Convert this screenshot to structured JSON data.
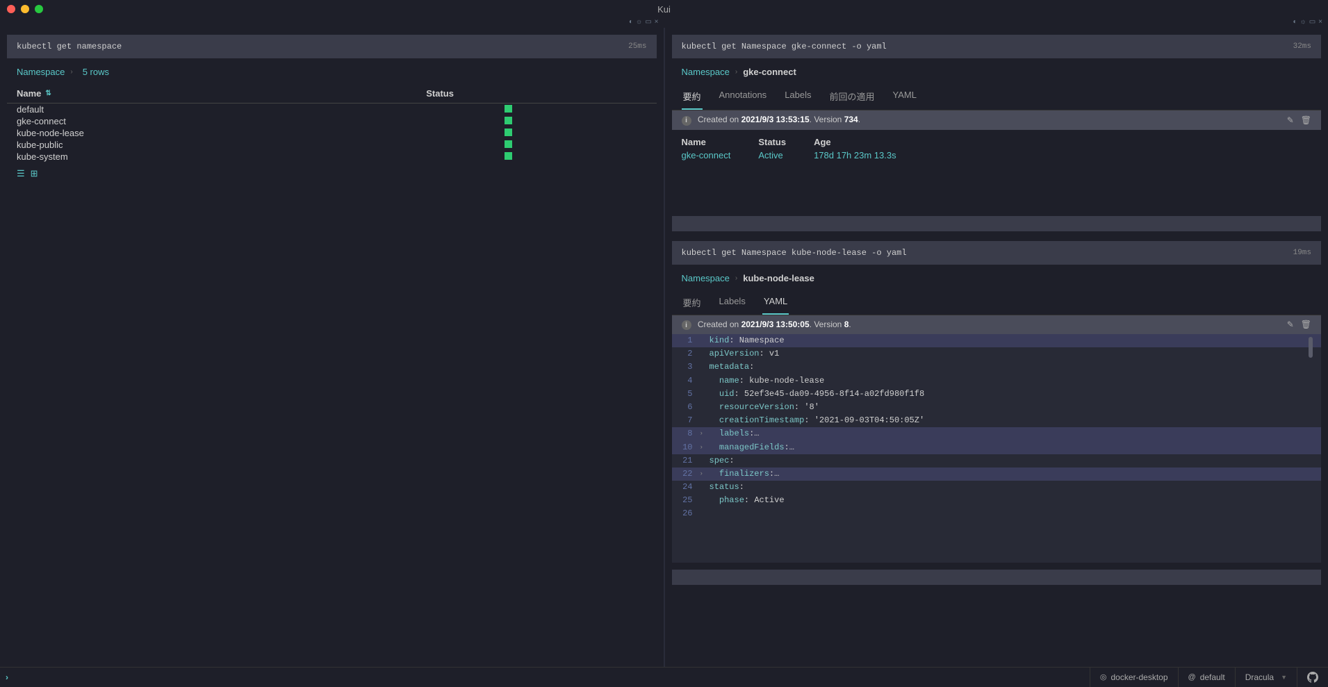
{
  "app_title": "Kui",
  "left_pane": {
    "command": "kubectl get namespace",
    "timing": "25ms",
    "breadcrumb_root": "Namespace",
    "breadcrumb_sub": "5 rows",
    "headers": {
      "name": "Name",
      "status": "Status"
    },
    "rows": [
      {
        "name": "default"
      },
      {
        "name": "gke-connect"
      },
      {
        "name": "kube-node-lease"
      },
      {
        "name": "kube-public"
      },
      {
        "name": "kube-system"
      }
    ]
  },
  "right_block1": {
    "command": "kubectl get Namespace gke-connect -o yaml",
    "timing": "32ms",
    "breadcrumb_root": "Namespace",
    "breadcrumb_current": "gke-connect",
    "tabs": [
      "要約",
      "Annotations",
      "Labels",
      "前回の適用",
      "YAML"
    ],
    "active_tab": 0,
    "info_prefix": "Created on ",
    "info_date": "2021/9/3 13:53:15",
    "info_mid": ". Version ",
    "info_version": "734",
    "info_suffix": ".",
    "summary": {
      "name_label": "Name",
      "name_val": "gke-connect",
      "status_label": "Status",
      "status_val": "Active",
      "age_label": "Age",
      "age_val": "178d 17h 23m 13.3s"
    }
  },
  "right_block2": {
    "command": "kubectl get Namespace kube-node-lease -o yaml",
    "timing": "19ms",
    "breadcrumb_root": "Namespace",
    "breadcrumb_current": "kube-node-lease",
    "tabs": [
      "要約",
      "Labels",
      "YAML"
    ],
    "active_tab": 2,
    "info_prefix": "Created on ",
    "info_date": "2021/9/3 13:50:05",
    "info_mid": ". Version ",
    "info_version": "8",
    "info_suffix": ".",
    "yaml": [
      {
        "n": "1",
        "hl": true,
        "fold": "",
        "key": "kind",
        "sep": ": ",
        "val": "Namespace"
      },
      {
        "n": "2",
        "hl": false,
        "fold": "",
        "key": "apiVersion",
        "sep": ": ",
        "val": "v1"
      },
      {
        "n": "3",
        "hl": false,
        "fold": "",
        "key": "metadata",
        "sep": ":",
        "val": ""
      },
      {
        "n": "4",
        "hl": false,
        "fold": "",
        "key": "  name",
        "sep": ": ",
        "val": "kube-node-lease"
      },
      {
        "n": "5",
        "hl": false,
        "fold": "",
        "key": "  uid",
        "sep": ": ",
        "val": "52ef3e45-da09-4956-8f14-a02fd980f1f8"
      },
      {
        "n": "6",
        "hl": false,
        "fold": "",
        "key": "  resourceVersion",
        "sep": ": ",
        "val": "'8'"
      },
      {
        "n": "7",
        "hl": false,
        "fold": "",
        "key": "  creationTimestamp",
        "sep": ": ",
        "val": "'2021-09-03T04:50:05Z'"
      },
      {
        "n": "8",
        "hl": true,
        "fold": "›",
        "key": "  labels",
        "sep": ":",
        "val": "…"
      },
      {
        "n": "10",
        "hl": true,
        "fold": "›",
        "key": "  managedFields",
        "sep": ":",
        "val": "…"
      },
      {
        "n": "21",
        "hl": false,
        "fold": "",
        "key": "spec",
        "sep": ":",
        "val": ""
      },
      {
        "n": "22",
        "hl": true,
        "fold": "›",
        "key": "  finalizers",
        "sep": ":",
        "val": "…"
      },
      {
        "n": "24",
        "hl": false,
        "fold": "",
        "key": "status",
        "sep": ":",
        "val": ""
      },
      {
        "n": "25",
        "hl": false,
        "fold": "",
        "key": "  phase",
        "sep": ": ",
        "val": "Active"
      },
      {
        "n": "26",
        "hl": false,
        "fold": "",
        "key": "",
        "sep": "",
        "val": ""
      }
    ]
  },
  "footer": {
    "context": "docker-desktop",
    "namespace": "default",
    "theme": "Dracula"
  }
}
